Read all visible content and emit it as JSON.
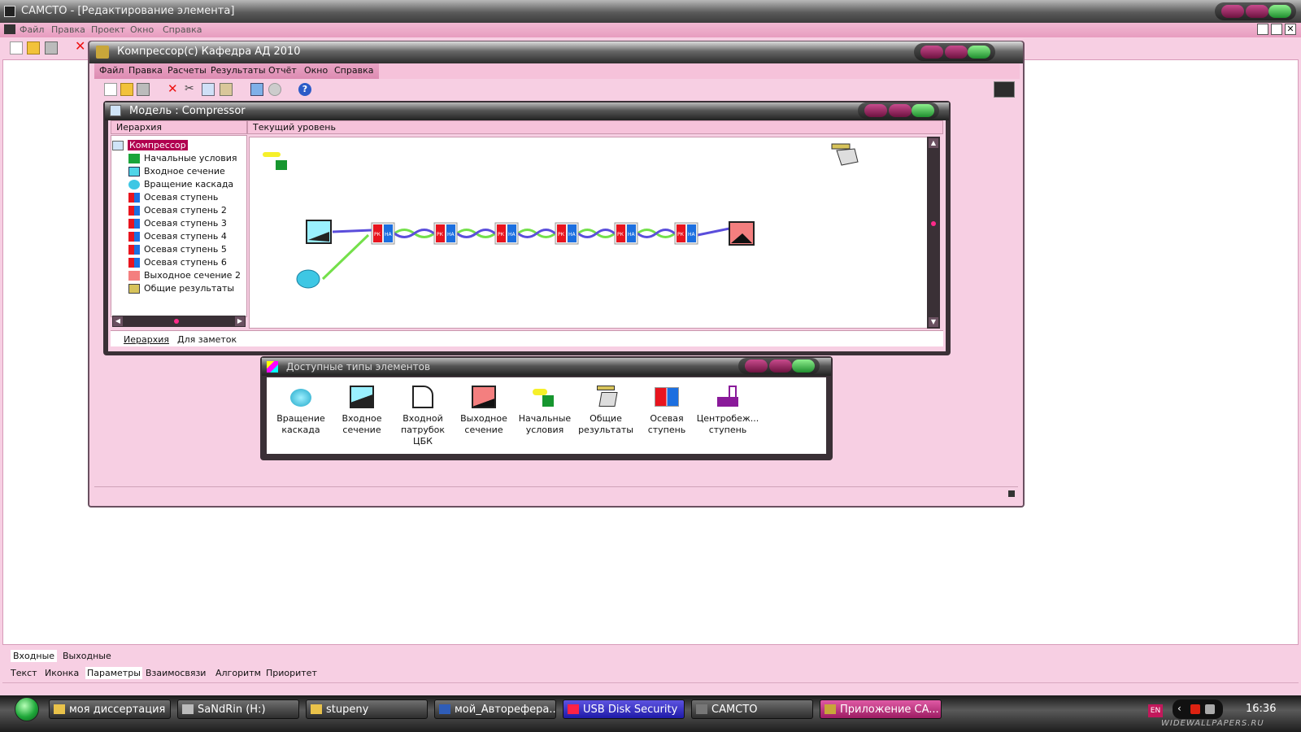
{
  "app": {
    "title": "CAMCTO - [Редактирование элемента]",
    "menu": [
      "Файл",
      "Правка",
      "Проект",
      "Окно",
      "Справка"
    ]
  },
  "inner_window": {
    "title": "Компрессор(с) Кафедра АД 2010",
    "menu": [
      "Файл",
      "Правка",
      "Расчеты",
      "Результаты",
      "Отчёт",
      "Окно",
      "Справка"
    ]
  },
  "model_window": {
    "title": "Модель : Compressor",
    "hierarchy_header": "Иерархия",
    "level_header": "Текущий уровень",
    "tree": {
      "root": "Компрессор",
      "items": [
        "Начальные условия",
        "Входное сечение",
        "Вращение каскада",
        "Осевая ступень",
        "Осевая ступень 2",
        "Осевая ступень 3",
        "Осевая ступень 4",
        "Осевая ступень 5",
        "Осевая ступень 6",
        "Выходное сечение 2",
        "Общие результаты"
      ]
    },
    "tabs": [
      "Иерархия",
      "Для заметок"
    ],
    "stage_labels": [
      "РК",
      "НА"
    ]
  },
  "palette": {
    "title": "Доступные типы элементов",
    "items": [
      {
        "l1": "Вращение",
        "l2": "каскада",
        "icon": "rotation-icon"
      },
      {
        "l1": "Входное",
        "l2": "сечение",
        "icon": "inlet-section-icon"
      },
      {
        "l1": "Входной",
        "l2": "патрубок ЦБК",
        "icon": "inlet-pipe-icon"
      },
      {
        "l1": "Выходное",
        "l2": "сечение",
        "icon": "outlet-section-icon"
      },
      {
        "l1": "Начальные",
        "l2": "условия",
        "icon": "initial-conditions-icon"
      },
      {
        "l1": "Общие",
        "l2": "результаты",
        "icon": "results-icon"
      },
      {
        "l1": "Осевая",
        "l2": "ступень",
        "icon": "axial-stage-icon"
      },
      {
        "l1": "Центробеж...",
        "l2": "ступень",
        "icon": "centrifugal-stage-icon"
      }
    ]
  },
  "bottom": {
    "tabs_row1": [
      "Входные",
      "Выходные"
    ],
    "tabs_row2": [
      "Текст",
      "Иконка",
      "Параметры",
      "Взаимосвязи",
      "Алгоритм",
      "Приоритет"
    ]
  },
  "taskbar": {
    "items": [
      "моя диссертация",
      "SaNdRin (H:)",
      "stupeny",
      "мой_Автореферa...",
      "USB Disk Security",
      "CAMCTO",
      "Приложение CA..."
    ],
    "lang": "EN",
    "clock": "16:36",
    "watermark": "WIDEWALLPAPERS.RU"
  },
  "colors": {
    "pink_bg": "#f7cfe3",
    "stage_red": "#e8141e",
    "stage_blue": "#1c6fe0",
    "link_blue": "#5a4ddb",
    "link_green": "#74e04a",
    "outlet": "#f47f7f"
  }
}
